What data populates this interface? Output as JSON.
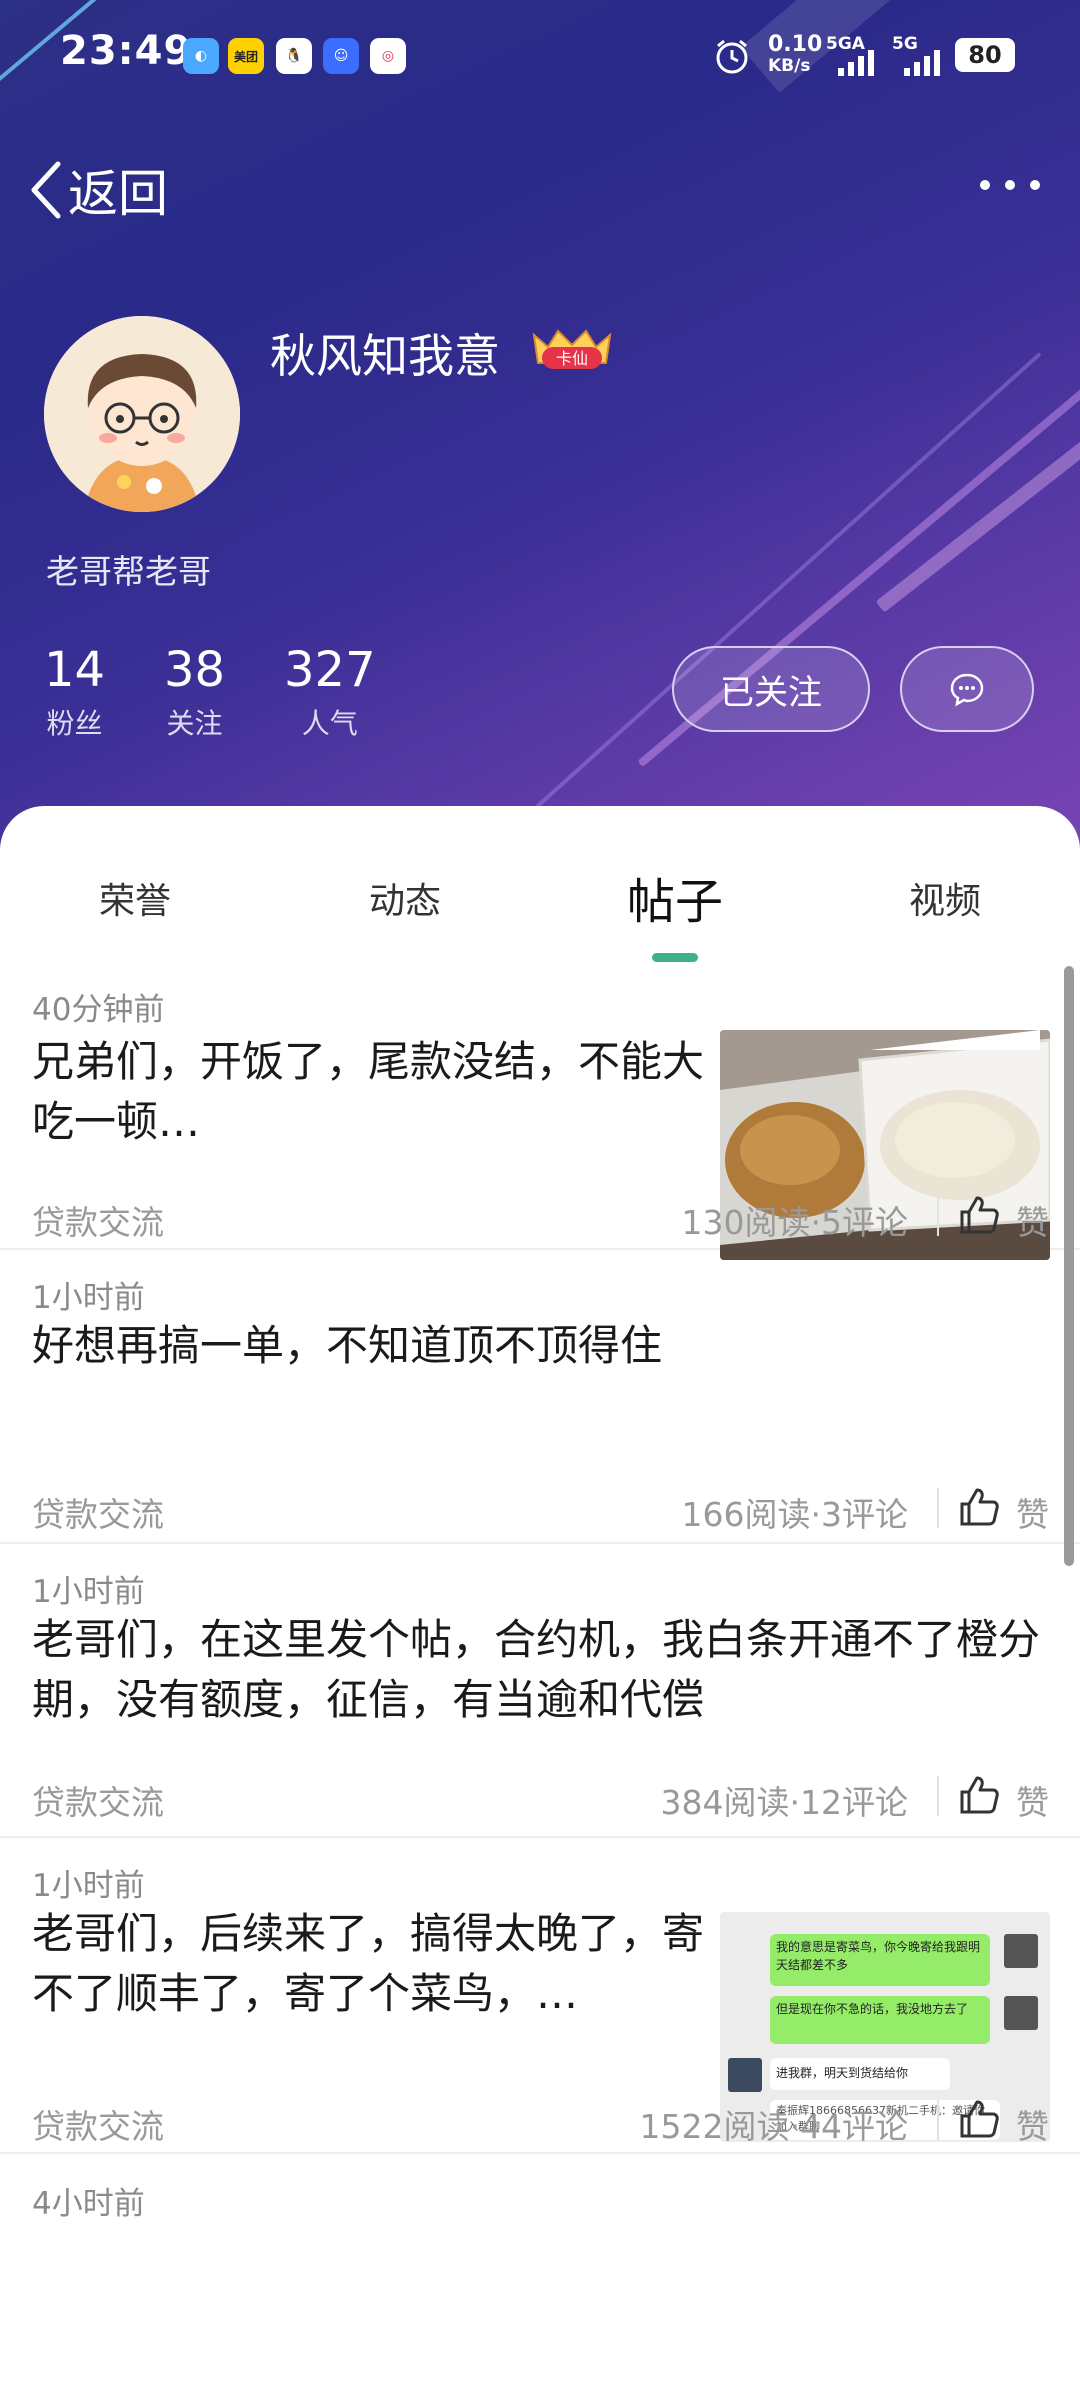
{
  "status_bar": {
    "time": "23:49",
    "meituan_label": "美团",
    "net_speed": "0.10",
    "net_unit": "KB/s",
    "sim1": "5GA",
    "sim2": "5G",
    "battery": "80"
  },
  "header": {
    "back_label": "返回"
  },
  "profile": {
    "name": "秋风知我意",
    "badge_text": "卡仙",
    "bio": "老哥帮老哥",
    "stats": [
      {
        "value": "14",
        "label": "粉丝"
      },
      {
        "value": "38",
        "label": "关注"
      },
      {
        "value": "327",
        "label": "人气"
      }
    ],
    "follow_label": "已关注"
  },
  "tabs": [
    {
      "label": "荣誉",
      "active": false
    },
    {
      "label": "动态",
      "active": false
    },
    {
      "label": "帖子",
      "active": true
    },
    {
      "label": "视频",
      "active": false
    }
  ],
  "posts": [
    {
      "time": "40分钟前",
      "title": "兄弟们，开饭了，尾款没结，不能大吃一顿…",
      "category": "贷款交流",
      "stats": "130阅读·5评论",
      "like_label": "赞",
      "has_image": true
    },
    {
      "time": "1小时前",
      "title": "好想再搞一单，不知道顶不顶得住",
      "category": "贷款交流",
      "stats": "166阅读·3评论",
      "like_label": "赞",
      "has_image": false
    },
    {
      "time": "1小时前",
      "title": "老哥们，在这里发个帖，合约机，我白条开通不了橙分期，没有额度，征信，有当逾和代偿",
      "category": "贷款交流",
      "stats": "384阅读·12评论",
      "like_label": "赞",
      "has_image": false
    },
    {
      "time": "1小时前",
      "title": "老哥们，后续来了，搞得太晚了，寄不了顺丰了，寄了个菜鸟，…",
      "category": "贷款交流",
      "stats": "1522阅读·44评论",
      "like_label": "赞",
      "has_image": true
    },
    {
      "time": "4小时前"
    }
  ],
  "chat_thumb": {
    "msg1": "我的意思是寄菜鸟，你今晚寄给我跟明天结都差不多",
    "msg2": "但是现在你不急的话，我没地方去了",
    "msg3": "进我群，明天到货结给你",
    "card": "秦振辉18666856637新机二手机：邀请你加入群聊"
  }
}
